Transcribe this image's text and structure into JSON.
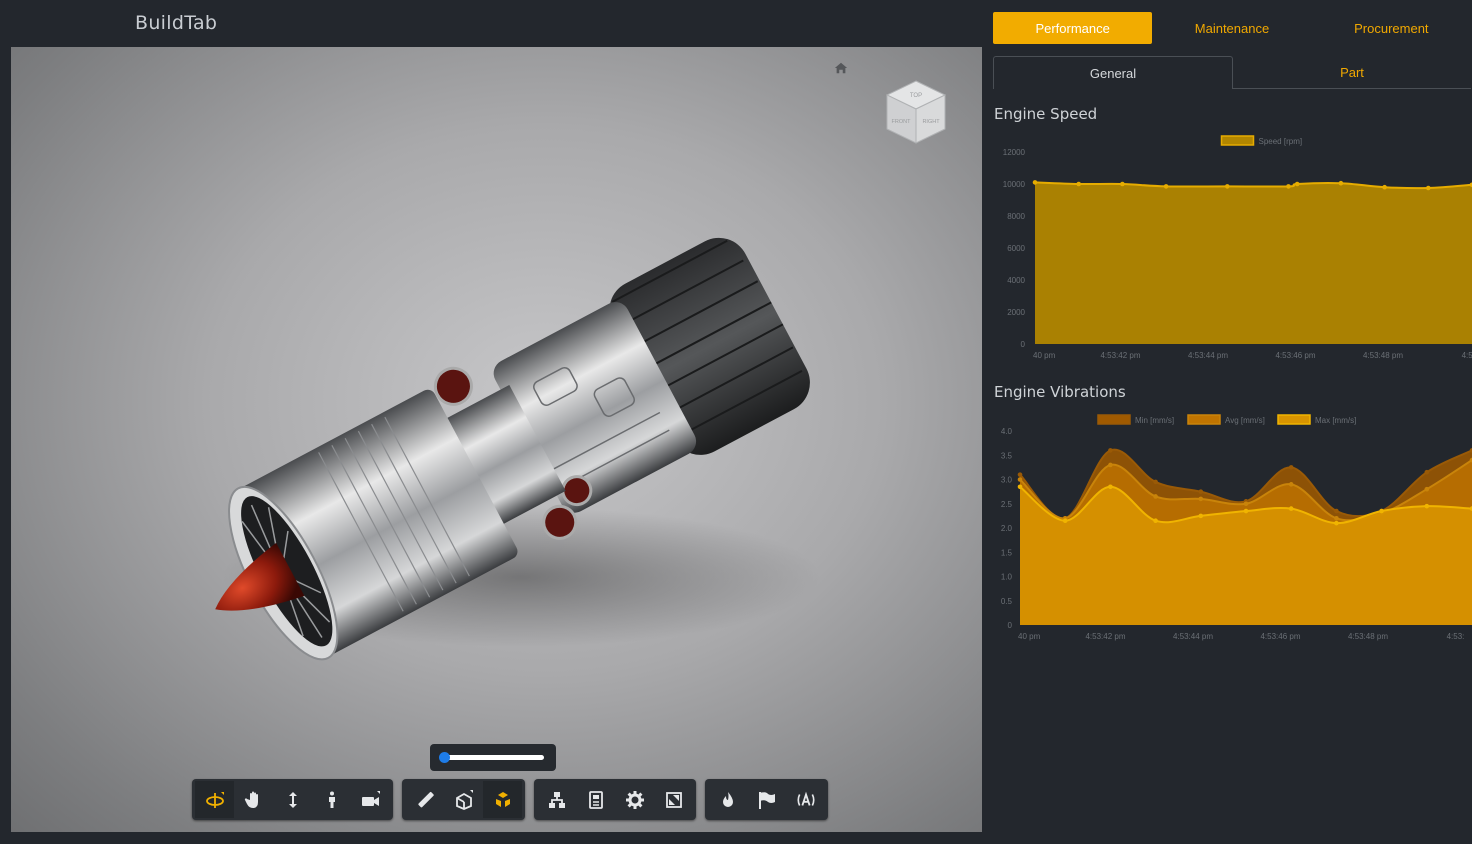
{
  "app": {
    "title": "BuildTab"
  },
  "tabs_top": [
    {
      "label": "Performance",
      "active": true
    },
    {
      "label": "Maintenance",
      "active": false
    },
    {
      "label": "Procurement",
      "active": false
    }
  ],
  "tabs_sub": [
    {
      "label": "General",
      "active": true
    },
    {
      "label": "Part",
      "active": false
    }
  ],
  "viewer": {
    "home_icon": "home-icon",
    "view_cube": {
      "faces": [
        "TOP",
        "FRONT",
        "RIGHT"
      ]
    },
    "section_slider_value": 0.02,
    "toolbar": [
      {
        "group": "navigation",
        "tools": [
          {
            "icon": "orbit-icon",
            "active": true
          },
          {
            "icon": "pan-icon",
            "active": false
          },
          {
            "icon": "zoom-icon",
            "active": false
          },
          {
            "icon": "first-person-icon",
            "active": false
          },
          {
            "icon": "camera-icon",
            "active": false
          }
        ]
      },
      {
        "group": "tools",
        "tools": [
          {
            "icon": "measure-icon",
            "active": false
          },
          {
            "icon": "section-icon",
            "active": false
          },
          {
            "icon": "explode-icon",
            "active": true
          }
        ]
      },
      {
        "group": "settings",
        "tools": [
          {
            "icon": "model-browser-icon",
            "active": false
          },
          {
            "icon": "properties-icon",
            "active": false
          },
          {
            "icon": "settings-icon",
            "active": false
          },
          {
            "icon": "fullscreen-icon",
            "active": false
          }
        ]
      },
      {
        "group": "extensions",
        "tools": [
          {
            "icon": "heat-icon",
            "active": false
          },
          {
            "icon": "flag-icon",
            "active": false
          },
          {
            "icon": "sensor-icon",
            "active": false
          }
        ]
      }
    ]
  },
  "colors": {
    "accent": "#f2ac00",
    "panel_bg": "#23272d",
    "speed_fill": "#b38600",
    "vib_fill": "#d48e00"
  },
  "chart_data": [
    {
      "id": "engine-speed",
      "type": "area",
      "title": "Engine Speed",
      "legend": [
        "Speed [rpm]"
      ],
      "legend_position": "top-center",
      "ylim": [
        0,
        12000
      ],
      "yticks": [
        "0",
        "2000",
        "4000",
        "6000",
        "8000",
        "10000",
        "12000"
      ],
      "xticks": [
        "40 pm",
        "4:53:42 pm",
        "4:53:44 pm",
        "4:53:46 pm",
        "4:53:48 pm",
        "4:53:"
      ],
      "series": [
        {
          "name": "Speed [rpm]",
          "x": [
            0,
            0.5,
            1.0,
            1.5,
            2.2,
            2.9,
            3.0,
            3.5,
            4.0,
            4.5,
            5.0
          ],
          "values": [
            10100,
            10000,
            10000,
            9850,
            9850,
            9850,
            10000,
            10050,
            9800,
            9750,
            9950
          ]
        }
      ]
    },
    {
      "id": "engine-vibrations",
      "type": "area",
      "title": "Engine Vibrations",
      "legend": [
        "Min [mm/s]",
        "Avg [mm/s]",
        "Max [mm/s]"
      ],
      "legend_position": "top-center",
      "ylim": [
        0,
        4.0
      ],
      "yticks": [
        "0",
        "0.5",
        "1.0",
        "1.5",
        "2.0",
        "2.5",
        "3.0",
        "3.5",
        "4.0"
      ],
      "xticks": [
        "40 pm",
        "4:53:42 pm",
        "4:53:44 pm",
        "4:53:46 pm",
        "4:53:48 pm",
        "4:53:"
      ],
      "series": [
        {
          "name": "Max [mm/s]",
          "x": [
            0,
            0.5,
            1.0,
            1.5,
            2.0,
            2.5,
            3.0,
            3.5,
            4.0,
            4.5,
            5.0
          ],
          "values": [
            3.1,
            2.2,
            3.6,
            2.95,
            2.75,
            2.55,
            3.25,
            2.35,
            2.35,
            3.15,
            3.6
          ]
        },
        {
          "name": "Avg [mm/s]",
          "x": [
            0,
            0.5,
            1.0,
            1.5,
            2.0,
            2.5,
            3.0,
            3.5,
            4.0,
            4.5,
            5.0
          ],
          "values": [
            3.0,
            2.2,
            3.3,
            2.65,
            2.6,
            2.5,
            2.9,
            2.2,
            2.3,
            2.8,
            3.4
          ]
        },
        {
          "name": "Min [mm/s]",
          "x": [
            0,
            0.5,
            1.0,
            1.5,
            2.0,
            2.5,
            3.0,
            3.5,
            4.0,
            4.5,
            5.0
          ],
          "values": [
            2.85,
            2.15,
            2.85,
            2.15,
            2.25,
            2.35,
            2.4,
            2.1,
            2.35,
            2.45,
            2.4
          ]
        }
      ]
    }
  ]
}
